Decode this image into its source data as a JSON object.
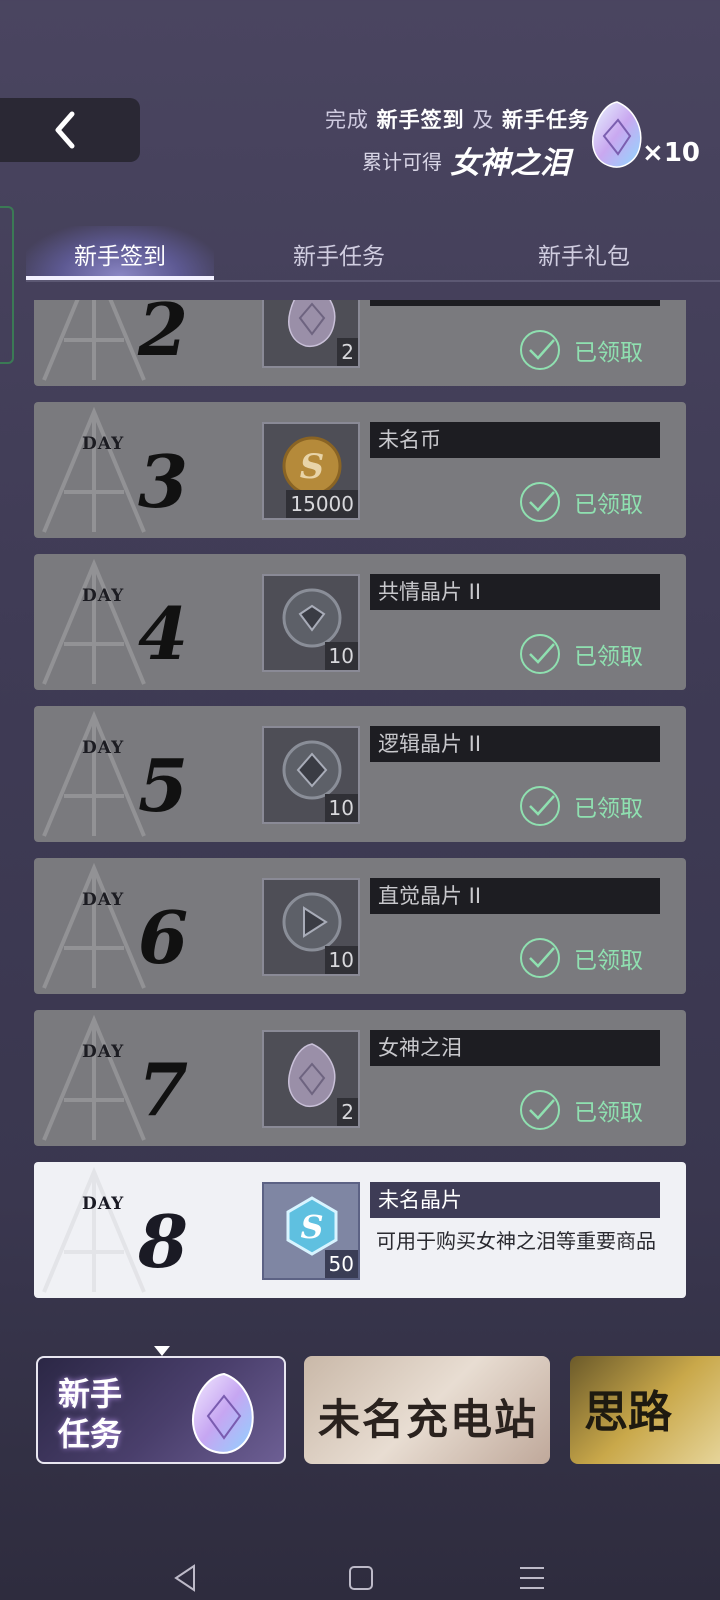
{
  "header": {
    "back_icon": "chevron-left-icon",
    "promo": {
      "prefix": "完成",
      "task_a": "新手签到",
      "joiner": "及",
      "task_b": "新手任务",
      "line2_prefix": "累计可得",
      "reward_name": "女神之泪",
      "reward_count": "×10"
    }
  },
  "tabs": [
    {
      "label": "新手签到",
      "active": true
    },
    {
      "label": "新手任务",
      "active": false
    },
    {
      "label": "新手礼包",
      "active": false
    }
  ],
  "signin": {
    "day_word": "DAY",
    "days": [
      {
        "day": "2",
        "item": "",
        "qty": "2",
        "status": "已领取"
      },
      {
        "day": "3",
        "item": "未名币",
        "qty": "15000",
        "status": "已领取"
      },
      {
        "day": "4",
        "item": "共情晶片 II",
        "qty": "10",
        "status": "已领取"
      },
      {
        "day": "5",
        "item": "逻辑晶片 II",
        "qty": "10",
        "status": "已领取"
      },
      {
        "day": "6",
        "item": "直觉晶片 II",
        "qty": "10",
        "status": "已领取"
      },
      {
        "day": "7",
        "item": "女神之泪",
        "qty": "2",
        "status": "已领取"
      },
      {
        "day": "8",
        "item": "未名晶片",
        "qty": "50",
        "desc": "可用于购买女神之泪等重要商品"
      }
    ]
  },
  "banners": [
    {
      "label": "新手\n任务"
    },
    {
      "label": "未名充电站"
    },
    {
      "label": "思路"
    }
  ],
  "colors": {
    "accent_claimed": "#8fe0b0",
    "tab_highlight": "#8a86c4"
  }
}
